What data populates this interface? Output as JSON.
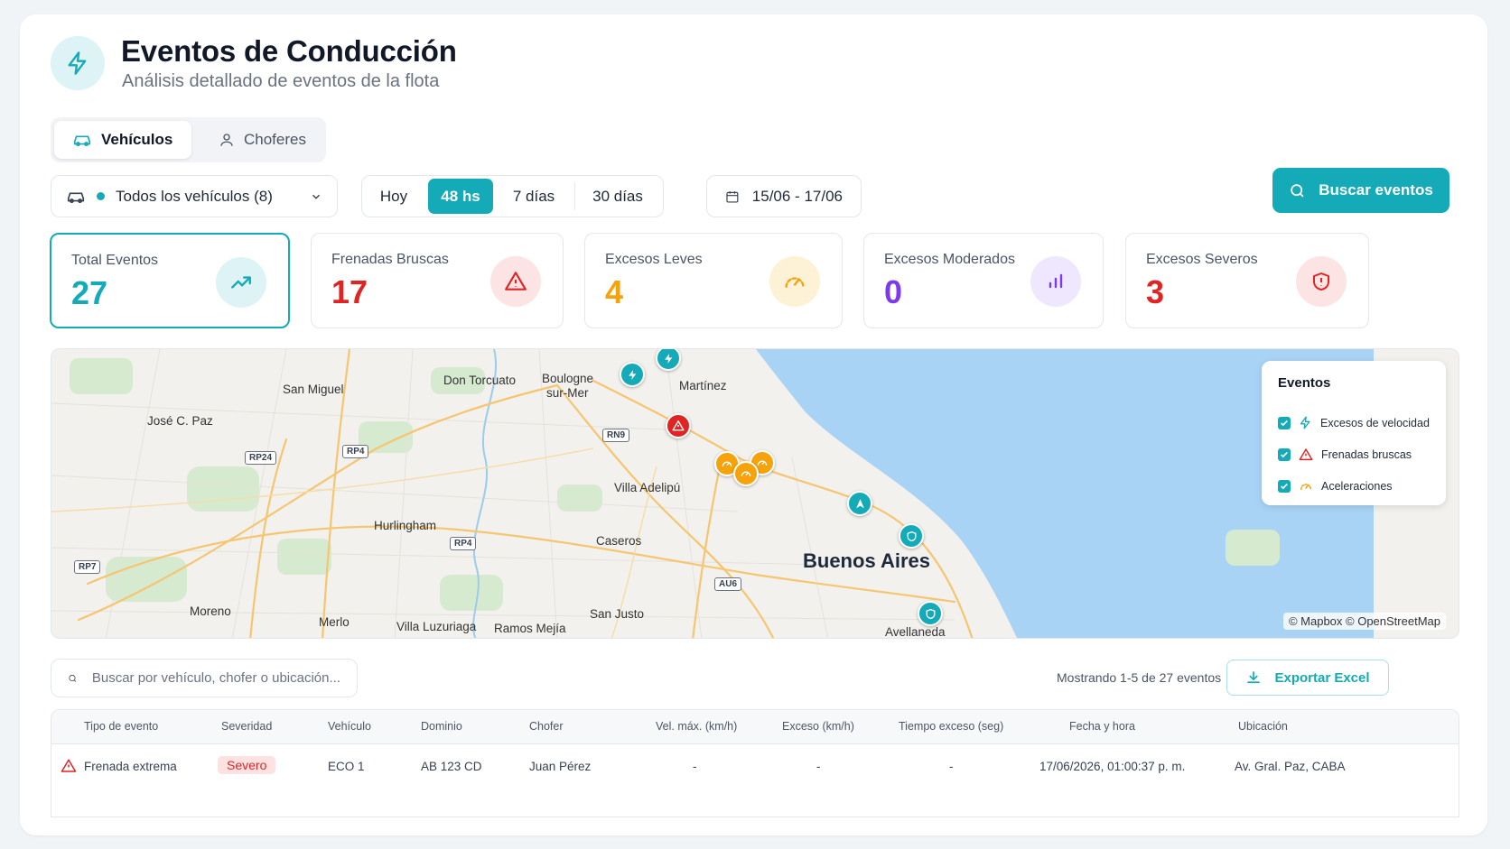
{
  "header": {
    "title": "Eventos de Conducción",
    "subtitle": "Análisis detallado de eventos de la flota",
    "icon": "bolt-icon"
  },
  "tabs": [
    {
      "label": "Vehículos",
      "icon": "car-icon",
      "active": true
    },
    {
      "label": "Choferes",
      "icon": "user-icon",
      "active": false
    }
  ],
  "filters": {
    "vehicle_select": "Todos los vehículos (8)",
    "ranges": [
      "Hoy",
      "48 hs",
      "7 días",
      "30 días"
    ],
    "selected_range": "48 hs",
    "date_range": "15/06 - 17/06",
    "search_button": "Buscar eventos"
  },
  "stats": [
    {
      "label": "Total Eventos",
      "value": "27",
      "color": "#14aab8",
      "icon": "trending-up-icon"
    },
    {
      "label": "Frenadas Bruscas",
      "value": "17",
      "color": "#e02424",
      "icon": "warning-icon"
    },
    {
      "label": "Excesos Leves",
      "value": "4",
      "color": "#f5a20b",
      "icon": "speedometer-icon"
    },
    {
      "label": "Excesos Moderados",
      "value": "0",
      "color": "#7c3aed",
      "icon": "bar-chart-icon"
    },
    {
      "label": "Excesos Severos",
      "value": "3",
      "color": "#e02424",
      "icon": "shield-alert-icon"
    }
  ],
  "map": {
    "places": [
      "San Miguel",
      "Don Torcuato",
      "Boulogne",
      "sur-Mer",
      "Martínez",
      "José C. Paz",
      "Villa Adelipú",
      "Hurlingham",
      "Caseros",
      "Buenos Aires",
      "Moreno",
      "Merlo",
      "Villa Luzuriaga",
      "Ramos Mejía",
      "San Justo",
      "Avellaneda"
    ],
    "roads": [
      "RP24",
      "RP4",
      "RN9",
      "RP4",
      "RP7",
      "AU6"
    ],
    "legend": {
      "title": "Eventos",
      "items": [
        "Excesos de velocidad",
        "Frenadas bruscas",
        "Aceleraciones"
      ]
    },
    "attribution": "© Mapbox © OpenStreetMap"
  },
  "table_toolbar": {
    "search_placeholder": "Buscar por vehículo, chofer o ubicación...",
    "showing": "Mostrando 1-5 de 27 eventos",
    "export_label": "Exportar Excel"
  },
  "table": {
    "columns": [
      "Tipo de evento",
      "Severidad",
      "Vehículo",
      "Dominio",
      "Chofer",
      "Vel. máx. (km/h)",
      "Exceso (km/h)",
      "Tiempo exceso (seg)",
      "Fecha y hora",
      "Ubicación"
    ],
    "rows": [
      {
        "tipo": "Frenada extrema",
        "severidad": "Severo",
        "vehiculo": "ECO 1",
        "dominio": "AB 123 CD",
        "chofer": "Juan Pérez",
        "vel_max": "-",
        "exceso": "-",
        "tiempo": "-",
        "fecha": "17/06/2026, 01:00:37 p. m.",
        "ubicacion": "Av. Gral. Paz, CABA"
      }
    ]
  },
  "colors": {
    "accent": "#14aab8",
    "danger": "#e02424",
    "warning": "#f5a20b",
    "purple": "#7c3aed"
  }
}
